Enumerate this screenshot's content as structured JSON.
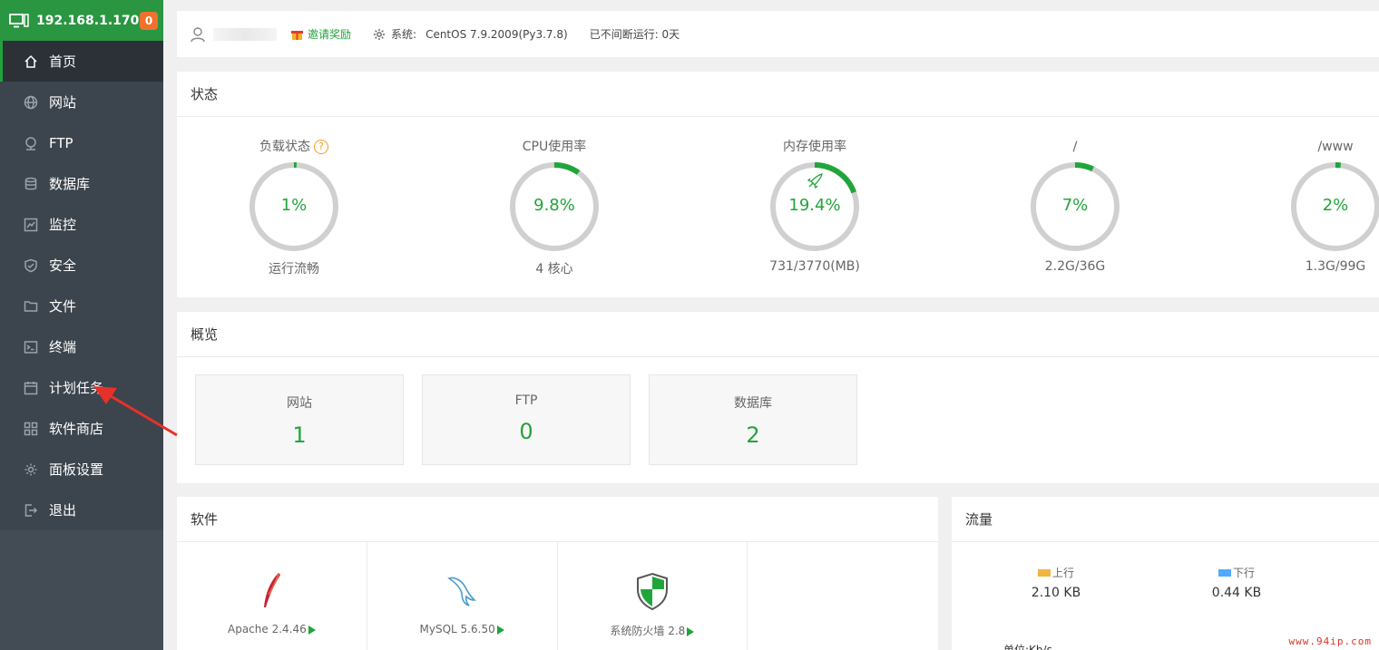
{
  "header": {
    "ip": "192.168.1.170",
    "badge": "0"
  },
  "menu": [
    {
      "label": "首页",
      "icon": "home-icon",
      "active": true
    },
    {
      "label": "网站",
      "icon": "globe-icon"
    },
    {
      "label": "FTP",
      "icon": "ftp-icon"
    },
    {
      "label": "数据库",
      "icon": "database-icon"
    },
    {
      "label": "监控",
      "icon": "monitor-chart-icon"
    },
    {
      "label": "安全",
      "icon": "shield-icon"
    },
    {
      "label": "文件",
      "icon": "folder-icon"
    },
    {
      "label": "终端",
      "icon": "terminal-icon"
    },
    {
      "label": "计划任务",
      "icon": "calendar-icon"
    },
    {
      "label": "软件商店",
      "icon": "grid-icon"
    },
    {
      "label": "面板设置",
      "icon": "gear-icon"
    },
    {
      "label": "退出",
      "icon": "logout-icon"
    }
  ],
  "topbar": {
    "invite": "邀请奖励",
    "sys_label": "系统:",
    "sys_value": "CentOS 7.9.2009(Py3.7.8)",
    "uptime": "已不间断运行: 0天"
  },
  "status": {
    "title": "状态",
    "gauges": [
      {
        "title": "负载状态",
        "value": "1%",
        "fraction": 0.01,
        "sub": "运行流畅",
        "help": "?"
      },
      {
        "title": "CPU使用率",
        "value": "9.8%",
        "fraction": 0.098,
        "sub": "4 核心"
      },
      {
        "title": "内存使用率",
        "value": "19.4%",
        "fraction": 0.194,
        "sub": "731/3770(MB)"
      },
      {
        "title": "/",
        "value": "7%",
        "fraction": 0.07,
        "sub": "2.2G/36G"
      },
      {
        "title": "/www",
        "value": "2%",
        "fraction": 0.02,
        "sub": "1.3G/99G"
      }
    ]
  },
  "overview": {
    "title": "概览",
    "items": [
      {
        "label": "网站",
        "value": "1"
      },
      {
        "label": "FTP",
        "value": "0"
      },
      {
        "label": "数据库",
        "value": "2"
      }
    ]
  },
  "software": {
    "title": "软件",
    "items": [
      {
        "name": "Apache 2.4.46"
      },
      {
        "name": "MySQL 5.6.50"
      },
      {
        "name": "系统防火墙 2.8"
      }
    ]
  },
  "traffic": {
    "title": "流量",
    "up_label": "上行",
    "up_value": "2.10 KB",
    "up_color": "#f0b440",
    "down_label": "下行",
    "down_value": "0.44 KB",
    "down_color": "#52a9ff",
    "unit": "单位:Kb/s"
  },
  "watermark": "www.94ip.com",
  "colors": {
    "accent": "#20a53a",
    "sidebar": "#3c444d",
    "header": "#2a9642"
  }
}
